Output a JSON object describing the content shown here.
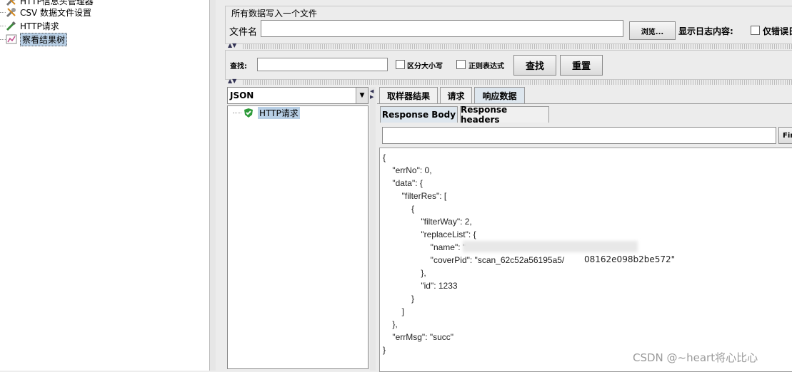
{
  "tree": {
    "items": [
      {
        "label": "HTTP信息头管理器",
        "icon": "wrench-icon"
      },
      {
        "label": "CSV 数据文件设置",
        "icon": "wrench-icon"
      },
      {
        "label": "HTTP请求",
        "icon": "pipette-icon"
      },
      {
        "label": "察看结果树",
        "icon": "chart-icon"
      }
    ]
  },
  "file_section": {
    "title": "所有数据写入一个文件",
    "filename_label": "文件名",
    "filename_value": "",
    "browse_label": "浏览...",
    "log_label": "显示日志内容:",
    "errors_only_label": "仅错误日"
  },
  "search": {
    "label": "查找:",
    "value": "",
    "case_label": "区分大小写",
    "regex_label": "正则表达式",
    "find_button": "查找",
    "reset_button": "重置"
  },
  "renderer": {
    "selected": "JSON"
  },
  "result_tree": {
    "item": "HTTP请求",
    "status_icon": "shield-check-icon"
  },
  "result_tabs": [
    "取样器结果",
    "请求",
    "响应数据"
  ],
  "response_tabs": [
    "Response Body",
    "Response headers"
  ],
  "find_button_cut": "Fin",
  "json_lines": [
    "{",
    "    \"errNo\": 0,",
    "    \"data\": {",
    "        \"filterRes\": [",
    "            {",
    "                \"filterWay\": 2,",
    "                \"replaceList\": {",
    "                    \"name\": \"",
    "                    \"coverPid\": \"scan_62c52a56195a5/",
    "                },",
    "                \"id\": 1233",
    "            }",
    "        ]",
    "    },",
    "    \"errMsg\": \"succ\"",
    "}"
  ],
  "cover_pid_tail": "08162e098b2be572\"",
  "watermark": "CSDN @~heart将心比心"
}
